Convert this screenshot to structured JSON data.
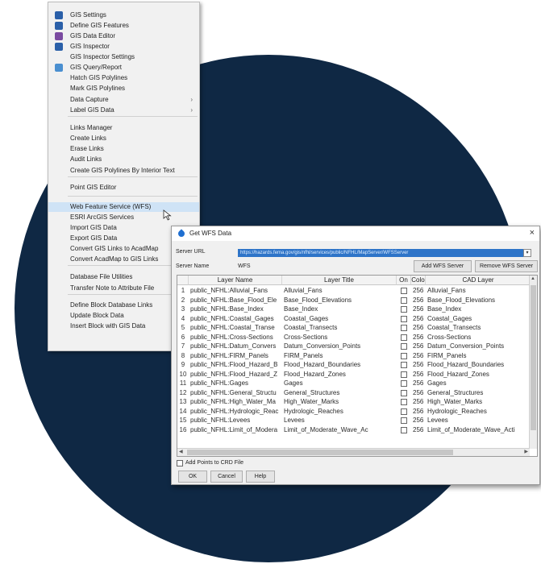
{
  "menu": {
    "items": [
      {
        "label": "GIS Settings",
        "icon": "gis-settings-icon",
        "color": "#2a5fa8",
        "has_submenu": false,
        "highlight": false
      },
      {
        "label": "Define GIS Features",
        "icon": "define-features-icon",
        "color": "#2a5fa8",
        "has_submenu": false,
        "highlight": false
      },
      {
        "label": "GIS Data Editor",
        "icon": "pencil-icon",
        "color": "#7a4aa0",
        "has_submenu": false,
        "highlight": false
      },
      {
        "label": "GIS Inspector",
        "icon": "inspector-icon",
        "color": "#2a5fa8",
        "has_submenu": false,
        "highlight": false
      },
      {
        "label": "GIS Inspector Settings",
        "icon": "",
        "has_submenu": false,
        "highlight": false
      },
      {
        "label": "GIS Query/Report",
        "icon": "query-report-icon",
        "color": "#4a8fd0",
        "has_submenu": false,
        "highlight": false
      },
      {
        "label": "Hatch GIS Polylines",
        "icon": "",
        "has_submenu": false,
        "highlight": false
      },
      {
        "label": "Mark GIS Polylines",
        "icon": "",
        "has_submenu": false,
        "highlight": false
      },
      {
        "label": "Data Capture",
        "icon": "",
        "has_submenu": true,
        "highlight": false
      },
      {
        "label": "Label GIS Data",
        "icon": "",
        "has_submenu": true,
        "highlight": false
      },
      {
        "label": "Links Manager",
        "icon": "",
        "has_submenu": false,
        "highlight": false
      },
      {
        "label": "Create Links",
        "icon": "",
        "has_submenu": false,
        "highlight": false
      },
      {
        "label": "Erase Links",
        "icon": "",
        "has_submenu": false,
        "highlight": false
      },
      {
        "label": "Audit Links",
        "icon": "",
        "has_submenu": false,
        "highlight": false
      },
      {
        "label": "Create GIS Polylines By Interior Text",
        "icon": "",
        "has_submenu": false,
        "highlight": false
      },
      {
        "label": "Point GIS Editor",
        "icon": "",
        "has_submenu": false,
        "highlight": false
      },
      {
        "label": "Web Feature Service (WFS)",
        "icon": "",
        "has_submenu": false,
        "highlight": true
      },
      {
        "label": "ESRI ArcGIS Services",
        "icon": "",
        "has_submenu": false,
        "highlight": false
      },
      {
        "label": "Import GIS Data",
        "icon": "",
        "has_submenu": false,
        "highlight": false
      },
      {
        "label": "Export GIS Data",
        "icon": "",
        "has_submenu": false,
        "highlight": false
      },
      {
        "label": "Convert GIS Links to AcadMap",
        "icon": "",
        "has_submenu": false,
        "highlight": false
      },
      {
        "label": "Convert AcadMap to GIS Links",
        "icon": "",
        "has_submenu": false,
        "highlight": false
      },
      {
        "label": "Database File Utilities",
        "icon": "",
        "has_submenu": false,
        "highlight": false
      },
      {
        "label": "Transfer Note to Attribute File",
        "icon": "",
        "has_submenu": false,
        "highlight": false
      },
      {
        "label": "Define Block Database Links",
        "icon": "",
        "has_submenu": false,
        "highlight": false
      },
      {
        "label": "Update Block Data",
        "icon": "",
        "has_submenu": false,
        "highlight": false
      },
      {
        "label": "Insert Block with GIS Data",
        "icon": "",
        "has_submenu": false,
        "highlight": false
      }
    ]
  },
  "dialog": {
    "title": "Get WFS Data",
    "close_glyph": "×",
    "server_url_label": "Server URL",
    "server_url_value": "https://hazards.fema.gov/gis/nfhl/services/public/NFHL/MapServer/WFSServer",
    "dropdown_glyph": "▾",
    "server_name_label": "Server Name",
    "server_name_value": "WFS",
    "add_server_label": "Add WFS Server",
    "remove_server_label": "Remove WFS Server",
    "columns": [
      "Layer Name",
      "Layer Title",
      "On",
      "Colo",
      "CAD Layer"
    ],
    "rows": [
      {
        "n": "1",
        "name": "public_NFHL:Alluvial_Fans",
        "title": "Alluvial_Fans",
        "color": "256",
        "cad": "Alluvial_Fans"
      },
      {
        "n": "2",
        "name": "public_NFHL:Base_Flood_Ele",
        "title": "Base_Flood_Elevations",
        "color": "256",
        "cad": "Base_Flood_Elevations"
      },
      {
        "n": "3",
        "name": "public_NFHL:Base_Index",
        "title": "Base_Index",
        "color": "256",
        "cad": "Base_Index"
      },
      {
        "n": "4",
        "name": "public_NFHL:Coastal_Gages",
        "title": "Coastal_Gages",
        "color": "256",
        "cad": "Coastal_Gages"
      },
      {
        "n": "5",
        "name": "public_NFHL:Coastal_Transe",
        "title": "Coastal_Transects",
        "color": "256",
        "cad": "Coastal_Transects"
      },
      {
        "n": "6",
        "name": "public_NFHL:Cross-Sections",
        "title": "Cross-Sections",
        "color": "256",
        "cad": "Cross-Sections"
      },
      {
        "n": "7",
        "name": "public_NFHL:Datum_Convers",
        "title": "Datum_Conversion_Points",
        "color": "256",
        "cad": "Datum_Conversion_Points"
      },
      {
        "n": "8",
        "name": "public_NFHL:FIRM_Panels",
        "title": "FIRM_Panels",
        "color": "256",
        "cad": "FIRM_Panels"
      },
      {
        "n": "9",
        "name": "public_NFHL:Flood_Hazard_B",
        "title": "Flood_Hazard_Boundaries",
        "color": "256",
        "cad": "Flood_Hazard_Boundaries"
      },
      {
        "n": "10",
        "name": "public_NFHL:Flood_Hazard_Z",
        "title": "Flood_Hazard_Zones",
        "color": "256",
        "cad": "Flood_Hazard_Zones"
      },
      {
        "n": "11",
        "name": "public_NFHL:Gages",
        "title": "Gages",
        "color": "256",
        "cad": "Gages"
      },
      {
        "n": "12",
        "name": "public_NFHL:General_Structu",
        "title": "General_Structures",
        "color": "256",
        "cad": "General_Structures"
      },
      {
        "n": "13",
        "name": "public_NFHL:High_Water_Ma",
        "title": "High_Water_Marks",
        "color": "256",
        "cad": "High_Water_Marks"
      },
      {
        "n": "14",
        "name": "public_NFHL:Hydrologic_Reac",
        "title": "Hydrologic_Reaches",
        "color": "256",
        "cad": "Hydrologic_Reaches"
      },
      {
        "n": "15",
        "name": "public_NFHL:Levees",
        "title": "Levees",
        "color": "256",
        "cad": "Levees"
      },
      {
        "n": "16",
        "name": "public_NFHL:Limit_of_Modera",
        "title": "Limit_of_Moderate_Wave_Ac",
        "color": "256",
        "cad": "Limit_of_Moderate_Wave_Acti"
      }
    ],
    "add_points_label": "Add Points to CRD File",
    "ok_label": "OK",
    "cancel_label": "Cancel",
    "help_label": "Help"
  },
  "colors": {
    "background_circle": "#0f2844",
    "highlight": "#cfe3f6",
    "url_selection": "#2e74c8"
  }
}
